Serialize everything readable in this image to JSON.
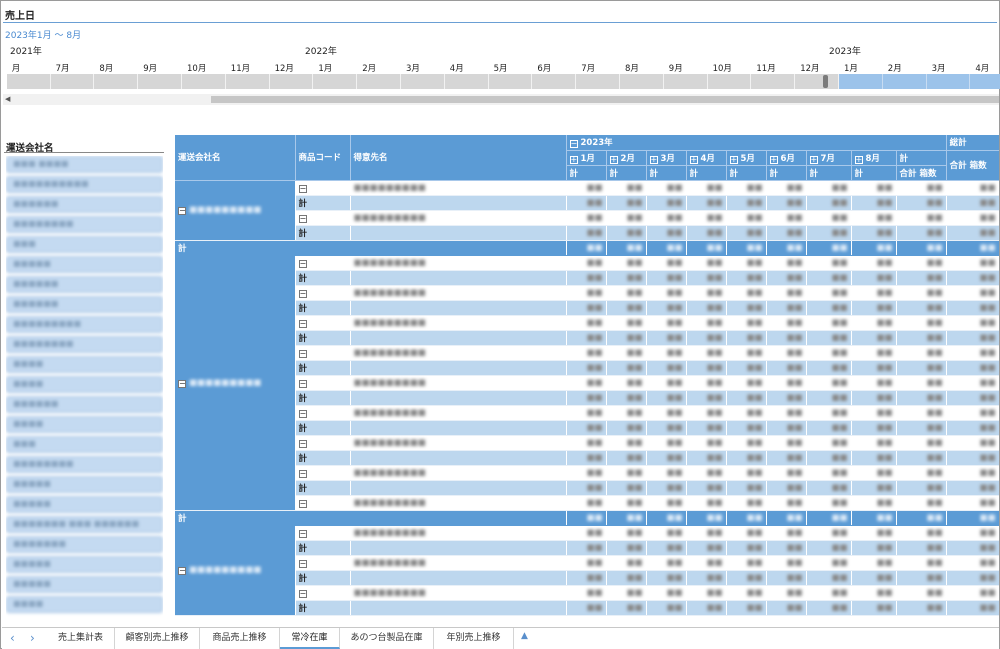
{
  "timeline": {
    "title": "売上日",
    "range": "2023年1月 ～ 8月",
    "years": [
      "2021年",
      "2022年",
      "2023年"
    ],
    "months": [
      "月",
      "7月",
      "8月",
      "9月",
      "10月",
      "11月",
      "12月",
      "1月",
      "2月",
      "3月",
      "4月",
      "5月",
      "6月",
      "7月",
      "8月",
      "9月",
      "10月",
      "11月",
      "12月",
      "1月",
      "2月",
      "3月",
      "4月"
    ]
  },
  "slicer": {
    "title": "運送会社名",
    "items": [
      "■■■ ■■■■",
      "■■■■■■■■■■",
      "■■■■■■",
      "■■■■■■■■",
      "■■■",
      "■■■■■",
      "■■■■■■",
      "■■■■■■",
      "■■■■■■■■■",
      "■■■■■■■■",
      "■■■■",
      "■■■■",
      "■■■■■■",
      "■■■■",
      "■■■",
      "■■■■■■■■",
      "■■■■■",
      "■■■■■",
      "■■■■■■■ ■■■ ■■■■■■",
      "■■■■■■■",
      "■■■■■",
      "■■■■■",
      "■■■■"
    ]
  },
  "pivot": {
    "headers": {
      "carrier": "運送会社名",
      "product": "商品コード",
      "customer": "得意先名",
      "year": "2023年",
      "months": [
        "1月",
        "2月",
        "3月",
        "4月",
        "5月",
        "6月",
        "7月",
        "8月"
      ],
      "total": "計",
      "total_sub1": "合計",
      "total_sub2": "箱数",
      "grand": "総計",
      "grand_sub1": "合計",
      "grand_sub2": "箱数",
      "sub": "計"
    },
    "subtotal_label": "計",
    "blurred_text": "■■■■■■■■■"
  },
  "tabs": {
    "items": [
      "売上集計表",
      "顧客別売上推移",
      "商品売上推移",
      "常冷在庫",
      "あのつ台製品在庫",
      "年別売上推移"
    ],
    "active": "常冷在庫"
  },
  "colors": {
    "header": "#5b9bd5",
    "subtotal": "#bdd7ee",
    "slicer": "#c4daf1"
  }
}
